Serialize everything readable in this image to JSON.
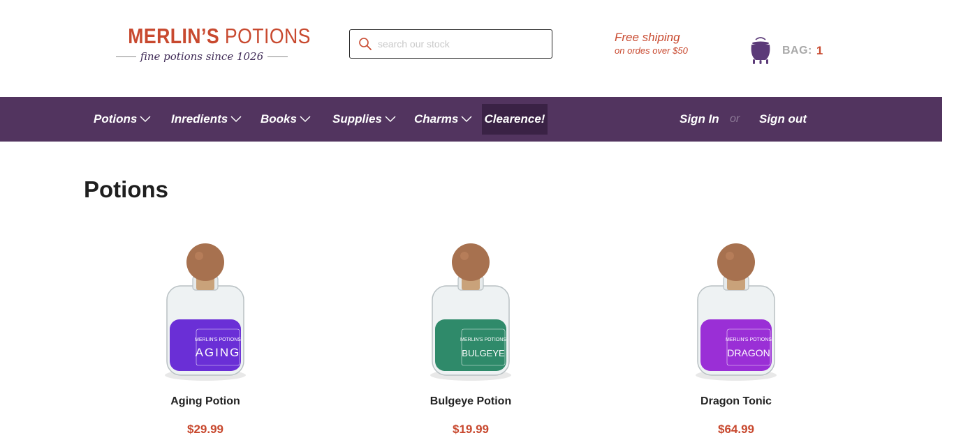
{
  "header": {
    "logo": {
      "title_bold": "MERLIN’S",
      "title_light": "POTIONS",
      "tagline": "fine potions since 1026"
    },
    "search": {
      "placeholder": "search our stock",
      "value": ""
    },
    "shipping": {
      "title": "Free shiping",
      "subtitle": "on ordes over $50"
    },
    "bag": {
      "label": "BAG:",
      "count": "1"
    }
  },
  "nav": {
    "items": [
      {
        "label": "Potions"
      },
      {
        "label": "Inredients"
      },
      {
        "label": "Books"
      },
      {
        "label": "Supplies"
      },
      {
        "label": "Charms"
      }
    ],
    "clearance": "Clearence!",
    "sign_in": "Sign In",
    "or": "or",
    "sign_out": "Sign out"
  },
  "main": {
    "title": "Potions",
    "products": [
      {
        "name": "Aging Potion",
        "price": "$29.99",
        "label": "AGING",
        "liquid_color": "#6a2fd6"
      },
      {
        "name": "Bulgeye Potion",
        "price": "$19.99",
        "label": "BULGEYE",
        "liquid_color": "#2f8a6a"
      },
      {
        "name": "Dragon Tonic",
        "price": "$64.99",
        "label": "DRAGON",
        "liquid_color": "#9a2fd6"
      }
    ]
  },
  "colors": {
    "brand_red": "#c8492f",
    "nav_purple": "#52345f",
    "nav_active": "#3a2245",
    "cauldron_purple": "#5b3a78"
  },
  "icons": [
    "search-icon",
    "cauldron-icon",
    "chevron-down-icon"
  ]
}
